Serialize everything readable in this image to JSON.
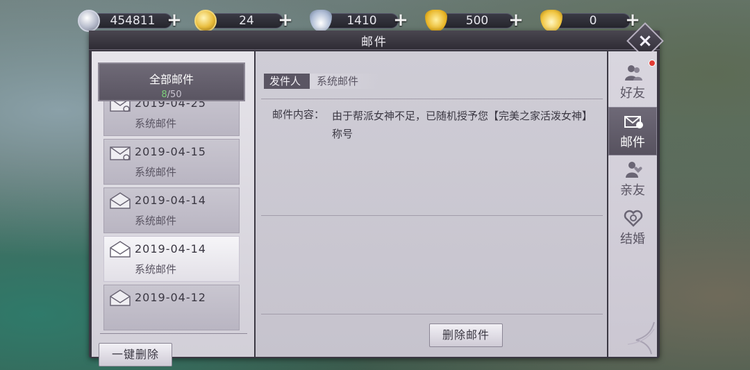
{
  "currencies": [
    {
      "value": "454811",
      "icon": "silver-coin-icon"
    },
    {
      "value": "24",
      "icon": "gold-coin-icon"
    },
    {
      "value": "1410",
      "icon": "silver-ingot-icon"
    },
    {
      "value": "500",
      "icon": "locked-gold-ingot-icon"
    },
    {
      "value": "0",
      "icon": "gold-ingot-icon"
    }
  ],
  "plus_label": "+",
  "window": {
    "title": "邮件",
    "close_label": "×"
  },
  "left_panel": {
    "tab_label": "全部邮件",
    "count_current": "8",
    "count_total": "/50",
    "mails": [
      {
        "date": "2019-04-25",
        "sender": "系统邮件",
        "attachment": true
      },
      {
        "date": "2019-04-15",
        "sender": "系统邮件",
        "attachment": true
      },
      {
        "date": "2019-04-14",
        "sender": "系统邮件",
        "attachment": false
      },
      {
        "date": "2019-04-14",
        "sender": "系统邮件",
        "attachment": false
      },
      {
        "date": "2019-04-12",
        "sender": "",
        "attachment": false
      }
    ],
    "delete_all_label": "一键删除"
  },
  "detail": {
    "sender_label": "发件人",
    "sender_name": "系统邮件",
    "content_label": "邮件内容：",
    "content_text": "由于帮派女神不足，已随机授予您【完美之家活泼女神】称号",
    "delete_label": "删除邮件"
  },
  "side_tabs": [
    {
      "label": "好友",
      "icon": "friends-icon"
    },
    {
      "label": "邮件",
      "icon": "mail-icon"
    },
    {
      "label": "亲友",
      "icon": "relatives-icon"
    },
    {
      "label": "结婚",
      "icon": "marriage-icon"
    }
  ],
  "colors": {
    "accent_count": "#7cd07a",
    "notification_dot": "#e23b35",
    "panel_dark": "#5a5563"
  }
}
